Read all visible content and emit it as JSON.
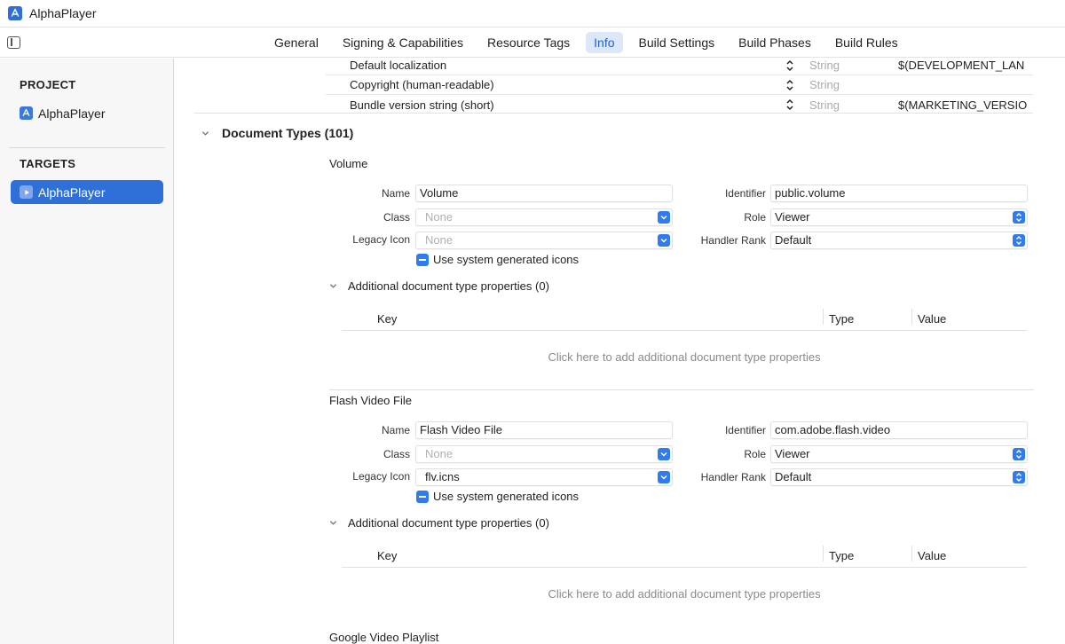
{
  "window": {
    "title": "AlphaPlayer"
  },
  "tabs": [
    {
      "label": "General",
      "active": false
    },
    {
      "label": "Signing & Capabilities",
      "active": false
    },
    {
      "label": "Resource Tags",
      "active": false
    },
    {
      "label": "Info",
      "active": true
    },
    {
      "label": "Build Settings",
      "active": false
    },
    {
      "label": "Build Phases",
      "active": false
    },
    {
      "label": "Build Rules",
      "active": false
    }
  ],
  "sidebar": {
    "project_label": "PROJECT",
    "project_item": "AlphaPlayer",
    "targets_label": "TARGETS",
    "target_item": "AlphaPlayer"
  },
  "properties": [
    {
      "key": "Default localization",
      "type": "String",
      "value": "$(DEVELOPMENT_LAN"
    },
    {
      "key": "Copyright (human-readable)",
      "type": "String",
      "value": ""
    },
    {
      "key": "Bundle version string (short)",
      "type": "String",
      "value": "$(MARKETING_VERSIO"
    }
  ],
  "document_types": {
    "header": "Document Types (101)",
    "labels": {
      "name": "Name",
      "class": "Class",
      "legacy_icon": "Legacy Icon",
      "identifier": "Identifier",
      "role": "Role",
      "handler_rank": "Handler Rank",
      "use_system_icons": "Use system generated icons",
      "key_col": "Key",
      "type_col": "Type",
      "value_col": "Value",
      "empty_hint": "Click here to add additional document type properties"
    },
    "items": [
      {
        "title": "Volume",
        "name": "Volume",
        "class_placeholder": "None",
        "legacy_icon": "None",
        "legacy_icon_placeholder": true,
        "identifier": "public.volume",
        "role": "Viewer",
        "handler_rank": "Default",
        "use_system_icons": true,
        "additional_props": "Additional document type properties (0)"
      },
      {
        "title": "Flash Video File",
        "name": "Flash Video File",
        "class_placeholder": "None",
        "legacy_icon": "flv.icns",
        "legacy_icon_placeholder": false,
        "identifier": "com.adobe.flash.video",
        "role": "Viewer",
        "handler_rank": "Default",
        "use_system_icons": true,
        "additional_props": "Additional document type properties (0)"
      },
      {
        "title": "Google Video Playlist"
      }
    ]
  },
  "colors": {
    "accent": "#2f6fd8",
    "control_blue": "#2f7bf0",
    "active_tab_bg": "#dce7fa"
  },
  "icons": {
    "app": "app-store-icon",
    "sidebar_toggle": "sidebar-toggle-icon",
    "disclosure": "chevron-down-icon",
    "stepper": "up-down-chevron-icon"
  }
}
